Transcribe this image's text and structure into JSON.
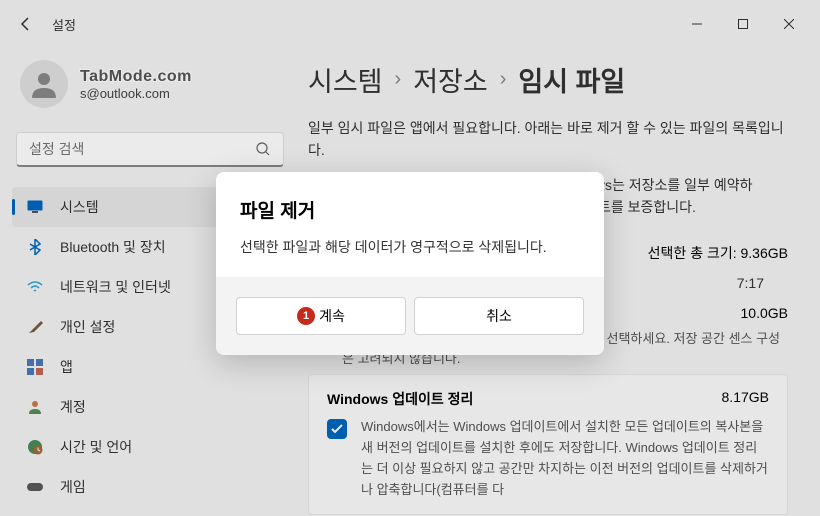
{
  "titlebar": {
    "title": "설정"
  },
  "user": {
    "watermark": "TabMode.com",
    "email": "s@outlook.com"
  },
  "search": {
    "placeholder": "설정 검색"
  },
  "sidebar": {
    "items": [
      {
        "label": "시스템",
        "icon": "system"
      },
      {
        "label": "Bluetooth 및 장치",
        "icon": "bluetooth"
      },
      {
        "label": "네트워크 및 인터넷",
        "icon": "network"
      },
      {
        "label": "개인 설정",
        "icon": "personalize"
      },
      {
        "label": "앱",
        "icon": "apps"
      },
      {
        "label": "계정",
        "icon": "accounts"
      },
      {
        "label": "시간 및 언어",
        "icon": "time"
      },
      {
        "label": "게임",
        "icon": "gaming"
      }
    ]
  },
  "breadcrumb": {
    "a": "시스템",
    "b": "저장소",
    "c": "임시 파일"
  },
  "main": {
    "desc1": "일부 임시 파일은 앱에서 필요합니다. 아래는 바로 제거 할 수 있는 파일의 목록입니다.",
    "desc2_suffix": "ys는 저장소를 일부 예약하",
    "desc2_suffix2": "트를 보증합니다.",
    "selected_label": "선택한 총 크기: 9.36GB",
    "time": "7:17",
    "card1": {
      "size": "10.0GB",
      "text": "있는 파일입니다. 모든 항목을 삭제하려면 이것을 선택하세요. 저장 공간 센스 구성은 고려되지 않습니다."
    },
    "card2": {
      "title": "Windows 업데이트 정리",
      "size": "8.17GB",
      "text": "Windows에서는 Windows 업데이트에서 설치한 모든 업데이트의 복사본을 새 버전의 업데이트를 설치한 후에도 저장합니다. Windows 업데이트 정리는 더 이상 필요하지 않고 공간만 차지하는 이전 버전의 업데이트를 삭제하거나 압축합니다(컴퓨터를 다"
    }
  },
  "dialog": {
    "title": "파일 제거",
    "message": "선택한 파일과 해당 데이터가 영구적으로 삭제됩니다.",
    "badge": "1",
    "continue": "계속",
    "cancel": "취소"
  }
}
